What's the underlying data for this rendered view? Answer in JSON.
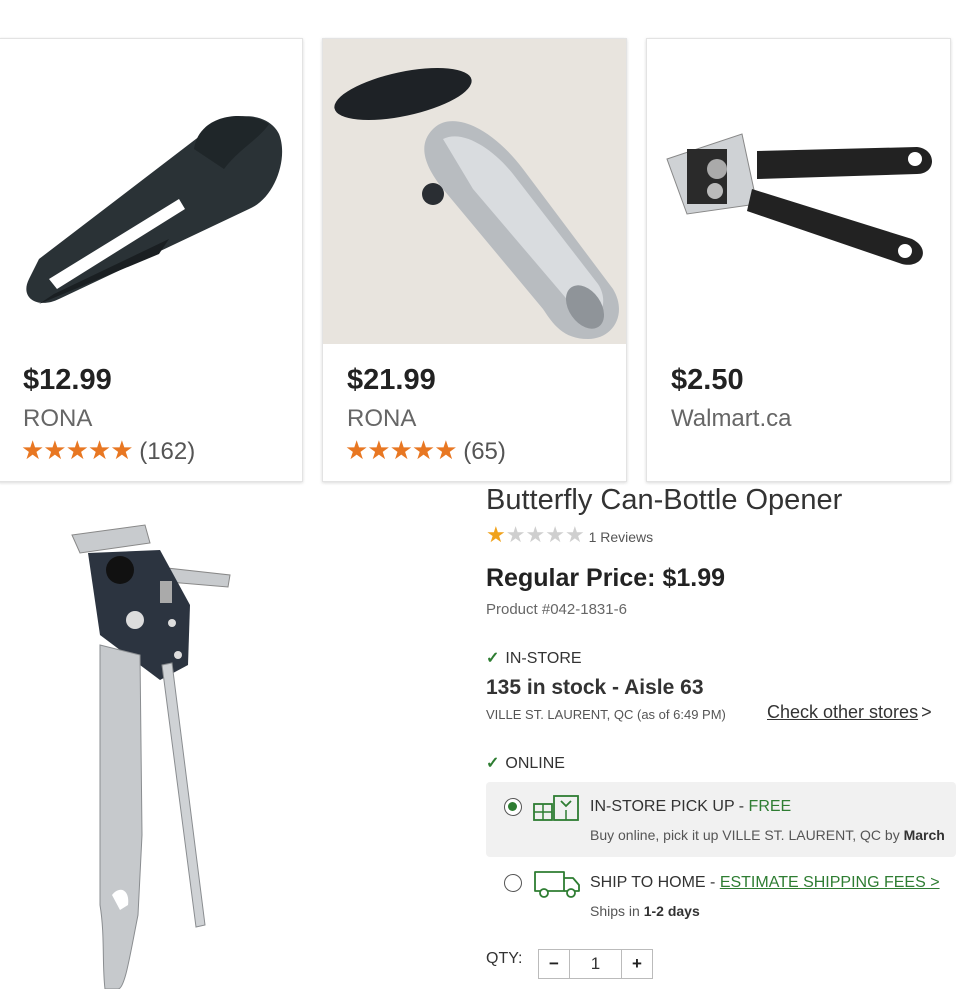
{
  "products": [
    {
      "price": "$12.99",
      "seller": "RONA",
      "stars": "★★★★★",
      "reviews": "(162)"
    },
    {
      "price": "$21.99",
      "seller": "RONA",
      "stars": "★★★★★",
      "reviews": "(65)"
    },
    {
      "price": "$2.50",
      "seller": "Walmart.ca"
    }
  ],
  "detail": {
    "title": "Butterfly Can-Bottle Opener",
    "rating": 1,
    "reviews_label": "1 Reviews",
    "regular_price": "Regular Price: $1.99",
    "product_number": "Product #042-1831-6",
    "instore_label": "IN-STORE",
    "stock": "135 in stock - Aisle 63",
    "location": "VILLE ST. LAURENT, QC (as of 6:49 PM)",
    "check_other": "Check other stores",
    "online_label": "ONLINE",
    "pickup_label": "IN-STORE PICK UP - ",
    "pickup_free": "FREE",
    "pickup_desc": "Buy online, pick it up VILLE ST. LAURENT, QC by ",
    "pickup_desc_bold": "March",
    "ship_label": "SHIP TO HOME - ",
    "ship_link": "ESTIMATE SHIPPING FEES >",
    "ship_desc": "Ships in ",
    "ship_desc_bold": "1-2 days",
    "qty_label": "QTY:",
    "qty_minus": "−",
    "qty_value": "1",
    "qty_plus": "+"
  },
  "colors": {
    "accent": "#2e7d32",
    "star_orange": "#e87722",
    "star_gold": "#f0a21b"
  }
}
